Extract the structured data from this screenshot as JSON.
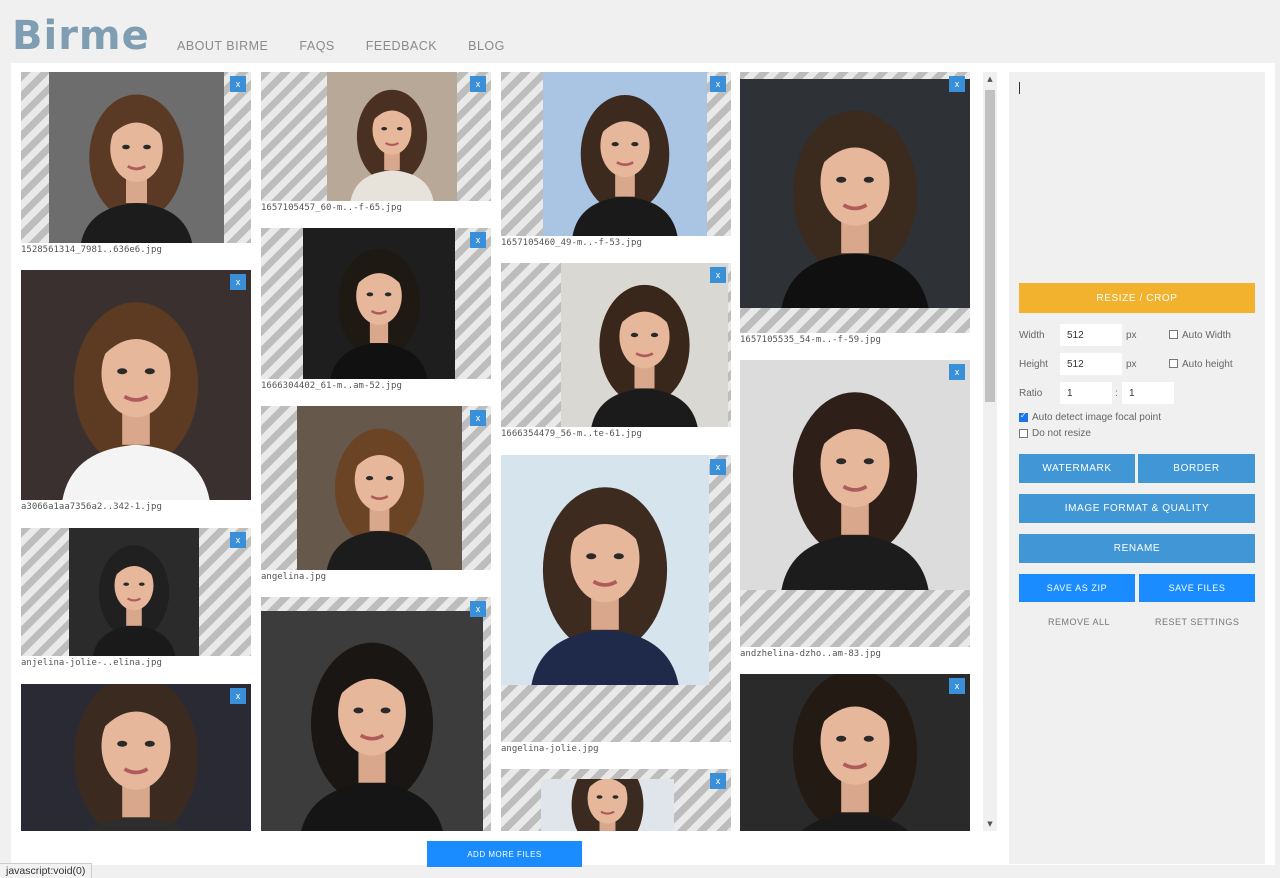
{
  "app": {
    "logo": "Birme"
  },
  "nav": [
    "ABOUT BIRME",
    "FAQS",
    "FEEDBACK",
    "BLOG"
  ],
  "images": [
    {
      "filename": "1528561314_7981..636e6.jpg",
      "hair": "#5a3a24",
      "bg": "#6d6d6d",
      "dress": "#1c1c1c"
    },
    {
      "filename": "a3066a1aa7356a2..342-1.jpg",
      "hair": "#5c3b22",
      "bg": "#3a3030",
      "dress": "#f4f4f4"
    },
    {
      "filename": "anjelina-jolie-..elina.jpg",
      "hair": "#202020",
      "bg": "#2b2b2b",
      "dress": "#1a1a1a"
    },
    {
      "filename": "",
      "hair": "#3b2a20",
      "bg": "#2a2a35",
      "dress": "#2d2d2d"
    },
    {
      "filename": "1657105457_60-m..-f-65.jpg",
      "hair": "#4a3020",
      "bg": "#b8a898",
      "dress": "#e8e3da"
    },
    {
      "filename": "1666304402_61-m..am-52.jpg",
      "hair": "#1f1914",
      "bg": "#1e1e1e",
      "dress": "#111111"
    },
    {
      "filename": "angelina.jpg",
      "hair": "#6b4426",
      "bg": "#66584a",
      "dress": "#1c1c1c"
    },
    {
      "filename": "",
      "hair": "#1a1614",
      "bg": "#3c3c3c",
      "dress": "#151515"
    },
    {
      "filename": "1657105460_49-m..-f-53.jpg",
      "hair": "#3c2a1f",
      "bg": "#aac4e3",
      "dress": "#1a1a1a"
    },
    {
      "filename": "1666354479_56-m..te-61.jpg",
      "hair": "#3a271c",
      "bg": "#dad8d2",
      "dress": "#1b1b1b"
    },
    {
      "filename": "angelina-jolie.jpg",
      "hair": "#3e2b20",
      "bg": "#d6e4ee",
      "dress": "#1f2a4a"
    },
    {
      "filename": "",
      "hair": "#3b2a20",
      "bg": "#dfe5ea",
      "dress": "#2a2a2a"
    },
    {
      "filename": "1657105535_54-m..-f-59.jpg",
      "hair": "#3b2a1e",
      "bg": "#2e3236",
      "dress": "#101010"
    },
    {
      "filename": "andzhelina-dzho..am-83.jpg",
      "hair": "#2e2018",
      "bg": "#dcdcdc",
      "dress": "#1c1c1c"
    },
    {
      "filename": "",
      "hair": "#241a14",
      "bg": "#2a2a2a",
      "dress": "#1a1a1a"
    }
  ],
  "close_label": "x",
  "add_more": "ADD MORE FILES",
  "settings": {
    "resize_crop": "RESIZE / CROP",
    "width_label": "Width",
    "width_value": "512",
    "width_unit": "px",
    "auto_width": "Auto Width",
    "height_label": "Height",
    "height_value": "512",
    "height_unit": "px",
    "auto_height": "Auto height",
    "ratio_label": "Ratio",
    "ratio_w": "1",
    "ratio_sep": ":",
    "ratio_h": "1",
    "auto_focal": "Auto detect image focal point",
    "auto_focal_checked": true,
    "no_resize": "Do not resize",
    "no_resize_checked": false,
    "watermark": "WATERMARK",
    "border": "BORDER",
    "format_quality": "IMAGE FORMAT & QUALITY",
    "rename": "RENAME",
    "save_zip": "SAVE AS ZIP",
    "save_files": "SAVE FILES",
    "remove_all": "REMOVE ALL",
    "reset_settings": "RESET SETTINGS"
  },
  "status_bar": "javascript:void(0)"
}
